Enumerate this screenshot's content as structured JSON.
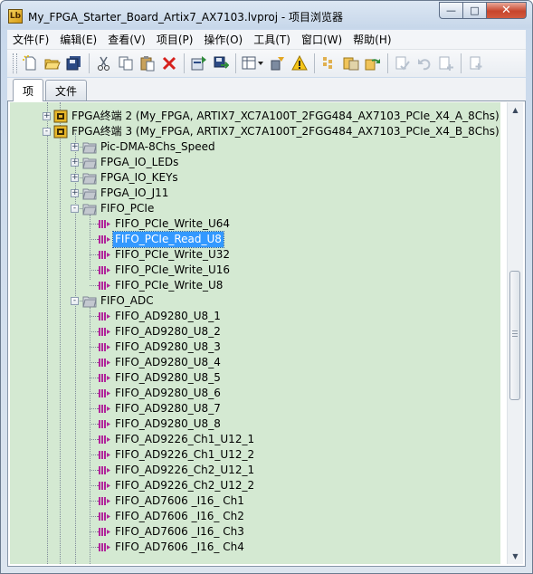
{
  "window": {
    "title": "My_FPGA_Starter_Board_Artix7_AX7103.lvproj - 项目浏览器",
    "app_icon": "Lb",
    "min_glyph": "—",
    "max_glyph": "□",
    "close_glyph": "✕"
  },
  "menubar": {
    "items": [
      "文件(F)",
      "编辑(E)",
      "查看(V)",
      "项目(P)",
      "操作(O)",
      "工具(T)",
      "窗口(W)",
      "帮助(H)"
    ]
  },
  "toolbar": {
    "groups": [
      [
        "new-icon",
        "open-icon",
        "save-all-icon"
      ],
      [
        "cut-icon",
        "copy-icon",
        "paste-icon",
        "delete-icon"
      ],
      [
        "build-icon",
        "deploy-icon"
      ],
      [
        "view-icon",
        "filter-icon",
        "warning-icon"
      ],
      [
        "resolve-icon",
        "dependencies-icon",
        "refresh-icon"
      ],
      [
        "scc-checkout-icon",
        "scc-undo-icon",
        "scc-add-icon"
      ],
      [
        "add-file-icon"
      ]
    ]
  },
  "tabs": {
    "items": "项",
    "files": "文件"
  },
  "tree": {
    "rows": [
      {
        "label": "FPGA终端 2 (My_FPGA, ARTIX7_XC7A100T_2FGG484_AX7103_PCIe_X4_A_8Chs)",
        "kind": "target",
        "expander": "+"
      },
      {
        "label": "FPGA终端 3 (My_FPGA, ARTIX7_XC7A100T_2FGG484_AX7103_PCIe_X4_B_8Chs)",
        "kind": "target",
        "expander": "-"
      },
      {
        "label": "Pic-DMA-8Chs_Speed",
        "kind": "folder",
        "expander": "+"
      },
      {
        "label": "FPGA_IO_LEDs",
        "kind": "folder",
        "expander": "+"
      },
      {
        "label": "FPGA_IO_KEYs",
        "kind": "folder",
        "expander": "+"
      },
      {
        "label": "FPGA_IO_J11",
        "kind": "folder",
        "expander": "+"
      },
      {
        "label": "FIFO_PCIe",
        "kind": "folder",
        "expander": "-"
      },
      {
        "label": "FIFO_PCIe_Write_U64",
        "kind": "fifo"
      },
      {
        "label": "FIFO_PCIe_Read_U8",
        "kind": "fifo",
        "selected": true
      },
      {
        "label": "FIFO_PCIe_Write_U32",
        "kind": "fifo"
      },
      {
        "label": "FIFO_PCIe_Write_U16",
        "kind": "fifo"
      },
      {
        "label": "FIFO_PCIe_Write_U8",
        "kind": "fifo"
      },
      {
        "label": "FIFO_ADC",
        "kind": "folder",
        "expander": "-"
      },
      {
        "label": "FIFO_AD9280_U8_1",
        "kind": "fifo"
      },
      {
        "label": "FIFO_AD9280_U8_2",
        "kind": "fifo"
      },
      {
        "label": "FIFO_AD9280_U8_3",
        "kind": "fifo"
      },
      {
        "label": "FIFO_AD9280_U8_4",
        "kind": "fifo"
      },
      {
        "label": "FIFO_AD9280_U8_5",
        "kind": "fifo"
      },
      {
        "label": "FIFO_AD9280_U8_6",
        "kind": "fifo"
      },
      {
        "label": "FIFO_AD9280_U8_7",
        "kind": "fifo"
      },
      {
        "label": "FIFO_AD9280_U8_8",
        "kind": "fifo"
      },
      {
        "label": "FIFO_AD9226_Ch1_U12_1",
        "kind": "fifo"
      },
      {
        "label": "FIFO_AD9226_Ch1_U12_2",
        "kind": "fifo"
      },
      {
        "label": "FIFO_AD9226_Ch2_U12_1",
        "kind": "fifo"
      },
      {
        "label": "FIFO_AD9226_Ch2_U12_2",
        "kind": "fifo"
      },
      {
        "label": "FIFO_AD7606 _I16_ Ch1",
        "kind": "fifo"
      },
      {
        "label": "FIFO_AD7606 _I16_ Ch2",
        "kind": "fifo"
      },
      {
        "label": "FIFO_AD7606 _I16_ Ch3",
        "kind": "fifo"
      },
      {
        "label": "FIFO_AD7606 _I16_ Ch4",
        "kind": "fifo"
      }
    ]
  },
  "scrollbar": {
    "up_glyph": "▲",
    "down_glyph": "▼",
    "position_fraction": 0.42
  },
  "colors": {
    "tree_background": "#d4e9d2",
    "selection": "#3399ff",
    "fifo_icon": "#b0259a",
    "folder": "#c8cdd4",
    "target_icon": "#e8b82a"
  }
}
